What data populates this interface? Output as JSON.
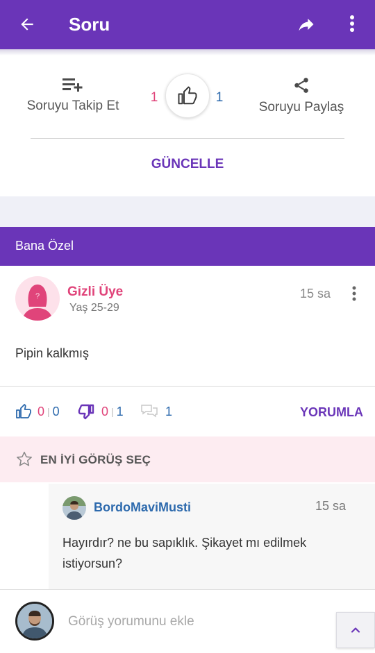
{
  "app_bar": {
    "title": "Soru",
    "background": "#6a35b8",
    "icons": {
      "back": "arrow-back-icon",
      "share": "share-forward-icon",
      "more": "more-vert-icon"
    }
  },
  "question_actions": {
    "follow_label": "Soruyu Takip Et",
    "share_label": "Soruyu Paylaş",
    "like_count_left": "1",
    "like_count_right": "1",
    "update_label": "GÜNCELLE"
  },
  "section": {
    "title": "Bana Özel"
  },
  "answer": {
    "author": "Gizli Üye",
    "age": "Yaş 25-29",
    "time": "15 sa",
    "text": "Pipin kalkmış",
    "likes_pink": "0",
    "likes_blue": "0",
    "dislikes_pink": "0",
    "dislikes_blue": "1",
    "comments": "1",
    "comment_action": "YORUMLA",
    "best_label": "EN İYİ GÖRÜŞ SEÇ"
  },
  "comment": {
    "author": "BordoMaviMusti",
    "time": "15 sa",
    "text": "Hayırdır? ne bu sapıklık. Şikayet mı edilmek istiyorsun?"
  },
  "composer": {
    "placeholder": "Görüş yorumunu ekle"
  },
  "colors": {
    "accent": "#6a35b8",
    "pink": "#e0447a",
    "blue": "#2d6aad",
    "best_bg": "#fdecf1"
  }
}
